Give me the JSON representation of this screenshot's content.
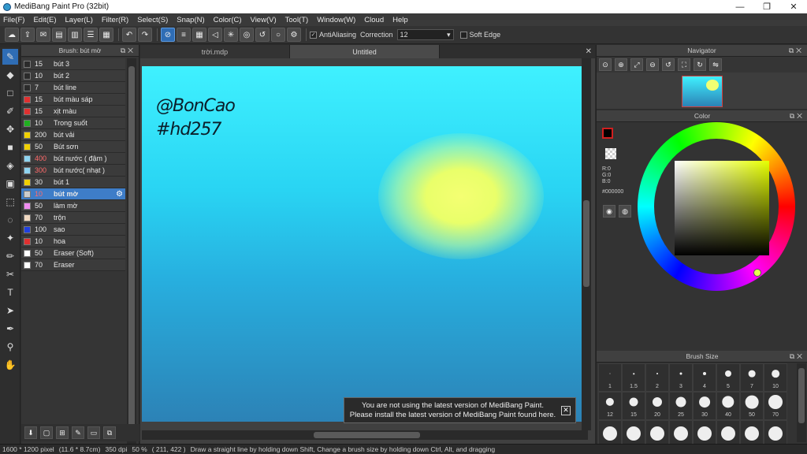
{
  "window": {
    "title": "MediBang Paint Pro (32bit)",
    "controls": [
      "—",
      "❐",
      "✕"
    ]
  },
  "menu": [
    "File(F)",
    "Edit(E)",
    "Layer(L)",
    "Filter(R)",
    "Select(S)",
    "Snap(N)",
    "Color(C)",
    "View(V)",
    "Tool(T)",
    "Window(W)",
    "Cloud",
    "Help"
  ],
  "toolbar": {
    "antialiasing_label": "AntiAliasing",
    "antialiasing_checked": "✓",
    "correction_label": "Correction",
    "correction_value": "12",
    "soft_edge_label": "Soft Edge"
  },
  "brush_panel": {
    "title": "Brush: bút mờ",
    "items": [
      {
        "size": "15",
        "name": "bút 3",
        "color": "#2b2b2b",
        "red": false
      },
      {
        "size": "10",
        "name": "bút 2",
        "color": "#2b2b2b",
        "red": false
      },
      {
        "size": "7",
        "name": "bút line",
        "color": "#2b2b2b",
        "red": false
      },
      {
        "size": "15",
        "name": "bút màu sáp",
        "color": "#e03030",
        "red": false
      },
      {
        "size": "15",
        "name": "xịt màu",
        "color": "#e03030",
        "red": false
      },
      {
        "size": "10",
        "name": "Trong suốt",
        "color": "#20b020",
        "red": false
      },
      {
        "size": "200",
        "name": "bút vải",
        "color": "#f0d000",
        "red": false
      },
      {
        "size": "50",
        "name": "Bút sơn",
        "color": "#f0d000",
        "red": false
      },
      {
        "size": "400",
        "name": "bút nước ( đậm )",
        "color": "#8fd4f0",
        "red": true
      },
      {
        "size": "300",
        "name": "bút nước( nhạt )",
        "color": "#8fd4f0",
        "red": true
      },
      {
        "size": "30",
        "name": "bút 1",
        "color": "#f0d000",
        "red": false
      },
      {
        "size": "10",
        "name": "bút mờ",
        "color": "#cccccc",
        "red": true,
        "selected": true
      },
      {
        "size": "50",
        "name": "làm mờ",
        "color": "#f08cf0",
        "red": false
      },
      {
        "size": "70",
        "name": "trộn",
        "color": "#f0d8c0",
        "red": false
      },
      {
        "size": "100",
        "name": "sao",
        "color": "#2040e0",
        "red": false
      },
      {
        "size": "10",
        "name": "hoa",
        "color": "#e03030",
        "red": false
      },
      {
        "size": "50",
        "name": "Eraser (Soft)",
        "color": "#ffffff",
        "red": false
      },
      {
        "size": "70",
        "name": "Eraser",
        "color": "#ffffff",
        "red": false
      }
    ]
  },
  "tabs": [
    "trời.mdp",
    "Untitled"
  ],
  "canvas": {
    "handwriting_line1": "@BonCao",
    "handwriting_line2": "#hd257"
  },
  "notification": {
    "line1": "You are not using the latest version of MediBang Paint.",
    "line2": "Please install the latest version of MediBang Paint found here.",
    "close": "✕"
  },
  "navigator": {
    "title": "Navigator"
  },
  "color_panel": {
    "title": "Color",
    "r": "R:0",
    "g": "G:0",
    "b": "B:0",
    "hex": "#000000",
    "accent": "#e6ff00"
  },
  "brush_size": {
    "title": "Brush Size",
    "sizes": [
      "1",
      "1.5",
      "2",
      "3",
      "4",
      "5",
      "7",
      "10",
      "12",
      "15",
      "20",
      "25",
      "30",
      "40",
      "50",
      "70",
      "",
      "",
      "",
      "",
      "",
      "",
      "",
      ""
    ]
  },
  "status": {
    "dimensions": "1600 * 1200 pixel",
    "physical": "(11.6 * 8.7cm)",
    "dpi": "350 dpi",
    "zoom": "50 %",
    "coords": "( 211, 422 )",
    "hint": "Draw a straight line by holding down Shift, Change a brush size by holding down Ctrl, Alt, and dragging"
  }
}
